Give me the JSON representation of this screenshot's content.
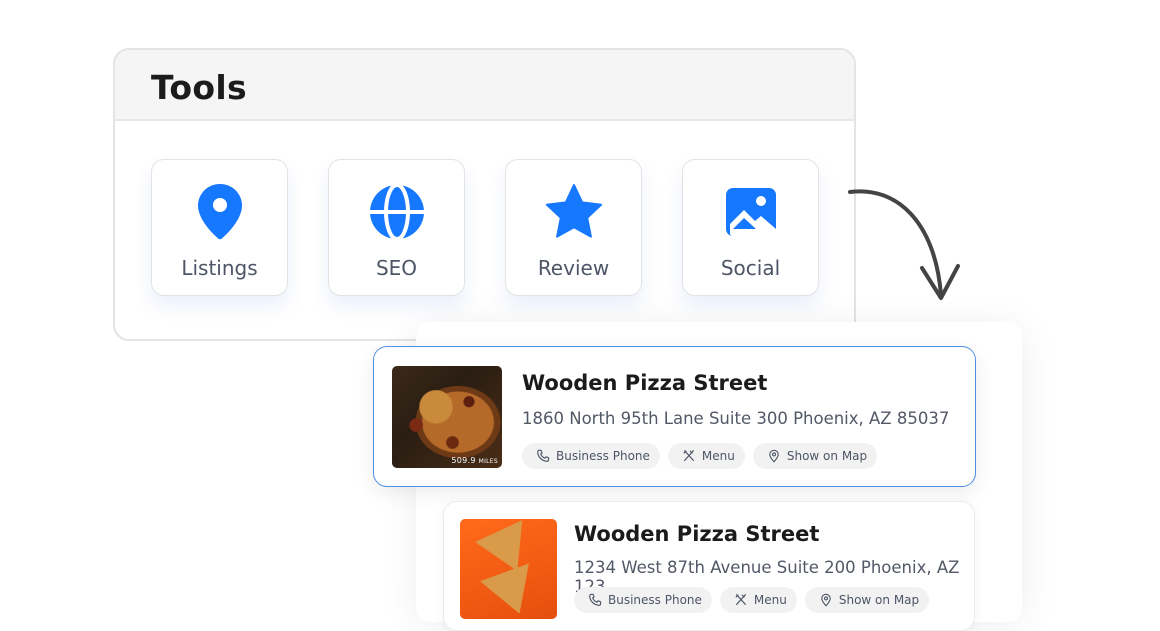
{
  "tools_panel": {
    "title": "Tools",
    "tools": [
      {
        "label": "Listings",
        "icon": "location-pin-icon"
      },
      {
        "label": "SEO",
        "icon": "globe-icon"
      },
      {
        "label": "Review",
        "icon": "star-icon"
      },
      {
        "label": "Social",
        "icon": "image-icon"
      }
    ]
  },
  "results": [
    {
      "name": "Wooden Pizza Street",
      "address": "1860 North 95th Lane Suite 300 Phoenix, AZ 85037",
      "distance": "509.9",
      "distance_unit": "MILES",
      "actions": [
        "Business Phone",
        "Menu",
        "Show on Map"
      ]
    },
    {
      "name": "Wooden Pizza Street",
      "address": "1234 West 87th Avenue Suite 200 Phoenix, AZ 123",
      "actions": [
        "Business Phone",
        "Menu",
        "Show on Map"
      ]
    }
  ],
  "colors": {
    "accent": "#1677ff",
    "selected_border": "#4f8fe0"
  }
}
